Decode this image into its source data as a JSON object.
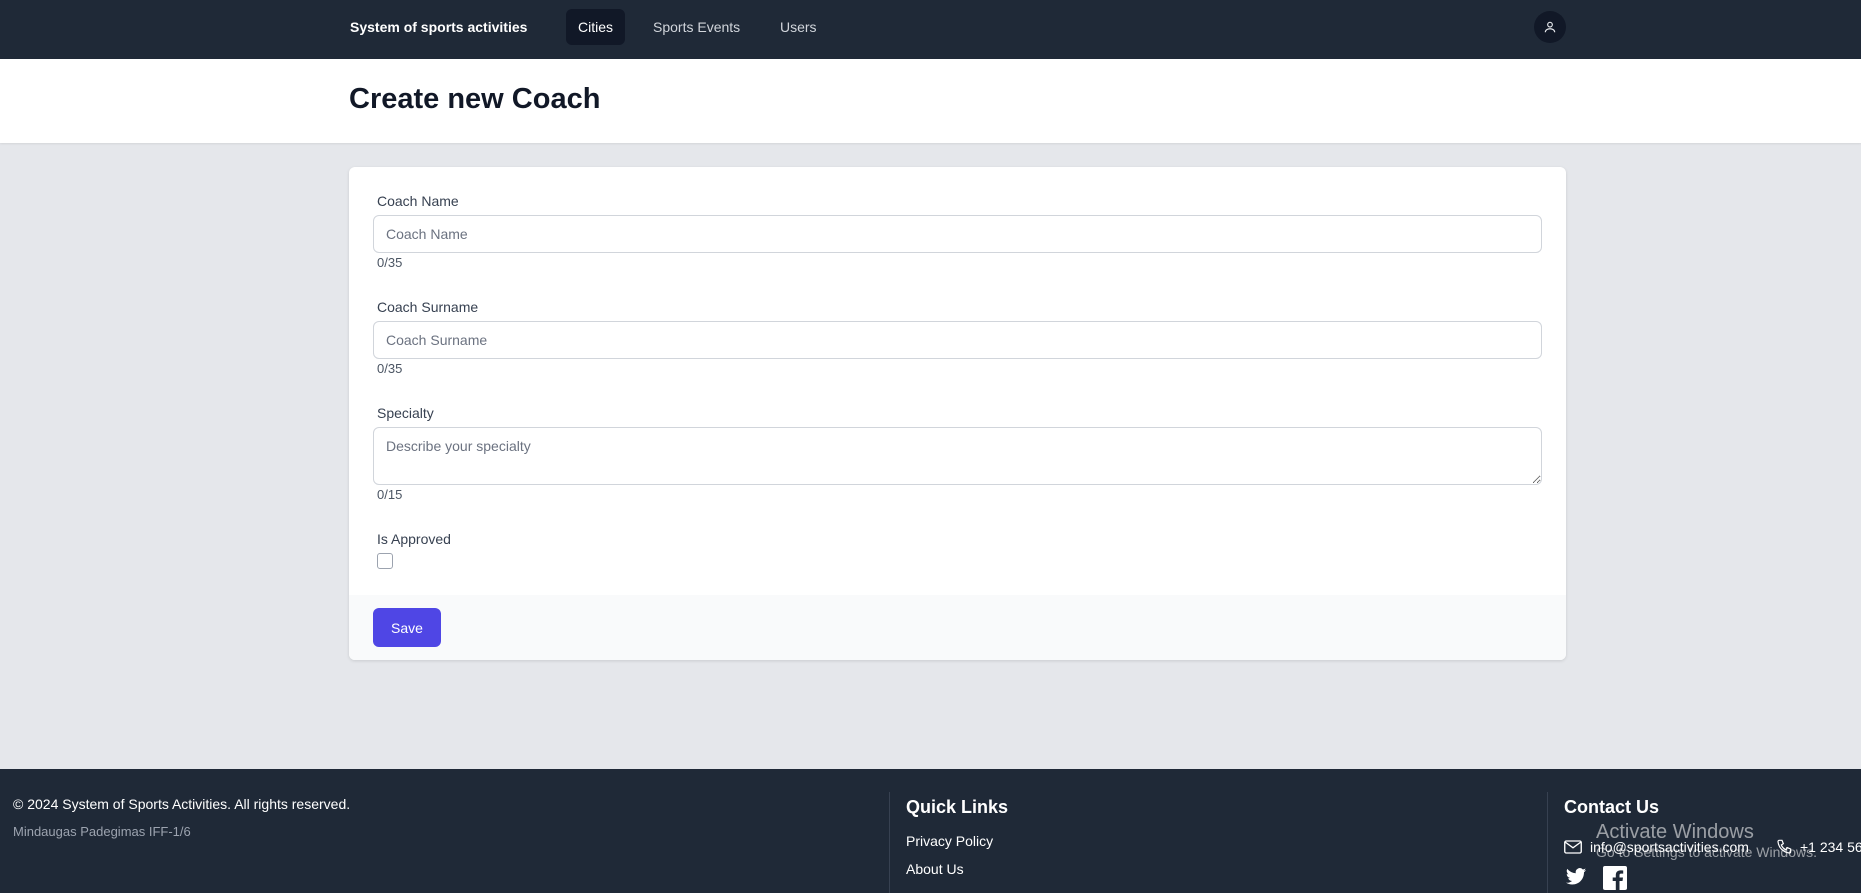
{
  "nav": {
    "brand": "System of sports activities",
    "links": [
      {
        "label": "Cities",
        "active": true
      },
      {
        "label": "Sports Events",
        "active": false
      },
      {
        "label": "Users",
        "active": false
      }
    ],
    "user_icon": "user-icon"
  },
  "header": {
    "title": "Create new Coach"
  },
  "form": {
    "coach_name": {
      "label": "Coach Name",
      "placeholder": "Coach Name",
      "value": "",
      "counter": "0/35"
    },
    "coach_surname": {
      "label": "Coach Surname",
      "placeholder": "Coach Surname",
      "value": "",
      "counter": "0/35"
    },
    "specialty": {
      "label": "Specialty",
      "placeholder": "Describe your specialty",
      "value": "",
      "counter": "0/15"
    },
    "is_approved": {
      "label": "Is Approved",
      "checked": false
    },
    "save_label": "Save"
  },
  "footer": {
    "copyright": "© 2024 System of Sports Activities. All rights reserved.",
    "author": "Mindaugas Padegimas IFF-1/6",
    "quick_links": {
      "heading": "Quick Links",
      "items": [
        "Privacy Policy",
        "About Us"
      ]
    },
    "contact": {
      "heading": "Contact Us",
      "email": "info@sportsactivities.com",
      "phone": "+1 234 56",
      "email_icon": "mail-icon",
      "phone_icon": "phone-icon",
      "social": [
        "twitter-icon",
        "facebook-icon"
      ]
    }
  },
  "overlay": {
    "line1": "Activate Windows",
    "line2": "Go to Settings to activate Windows."
  },
  "colors": {
    "navbar": "#1f2937",
    "accent": "#4f46e5",
    "background": "#e5e7eb"
  }
}
